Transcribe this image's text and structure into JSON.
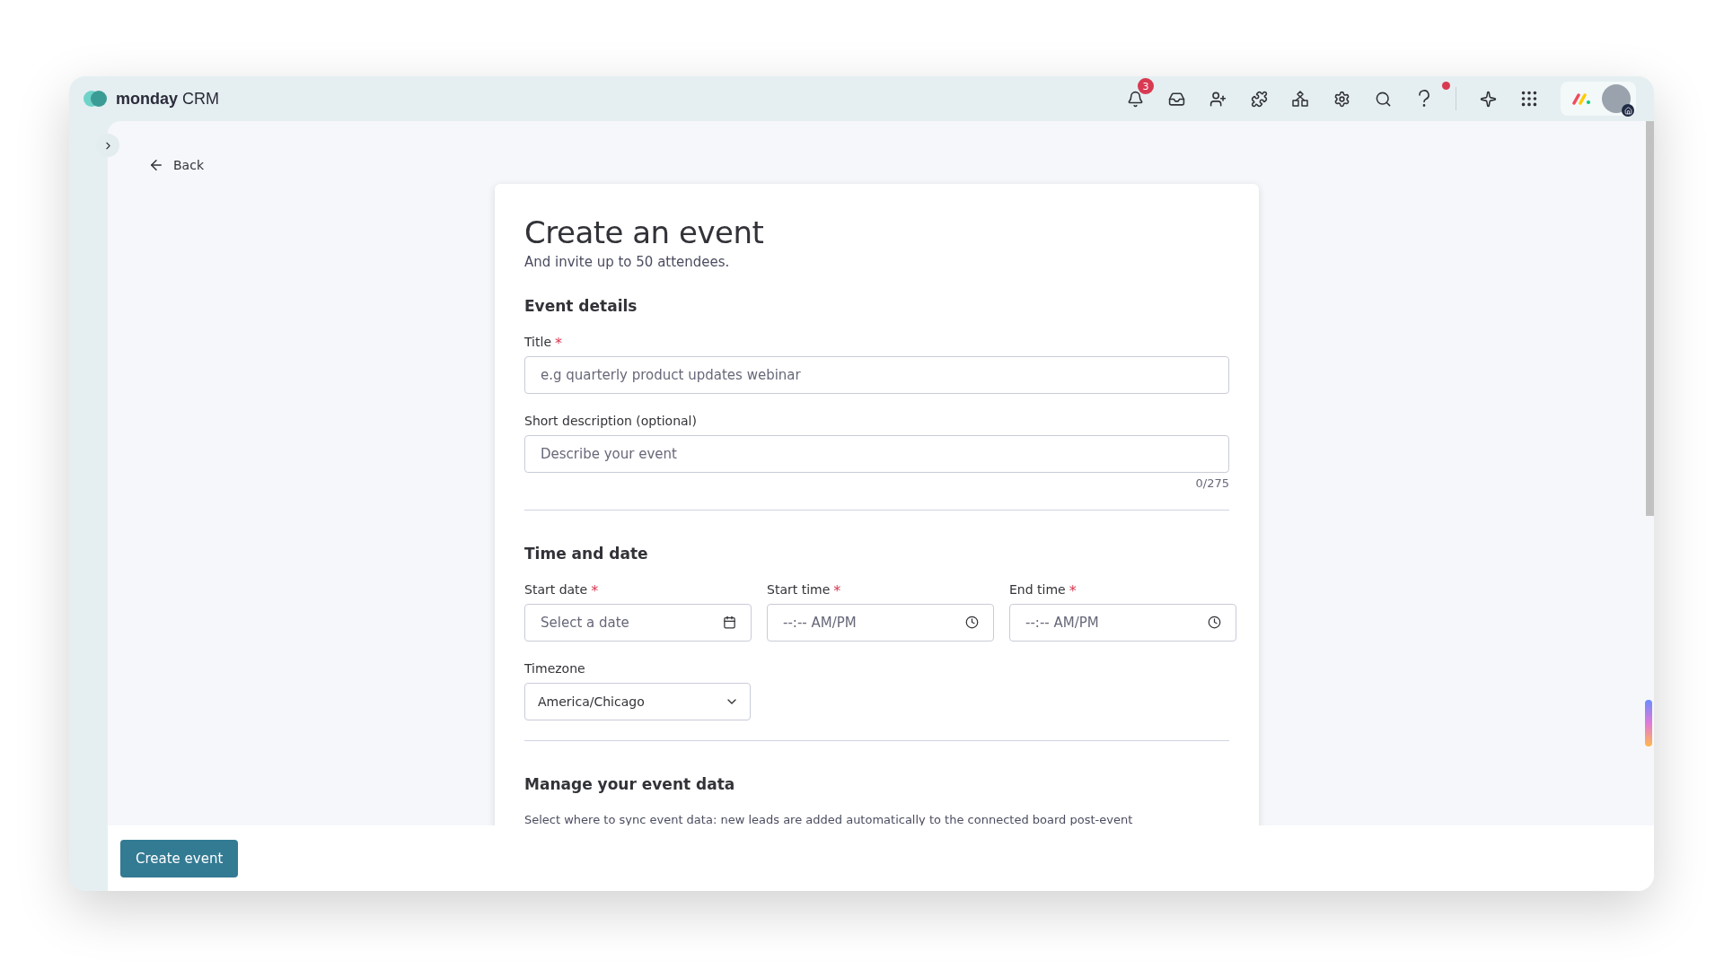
{
  "brand": {
    "name": "monday",
    "suffix": "CRM"
  },
  "header": {
    "notification_count": "3",
    "help_alert": true
  },
  "back": "Back",
  "form": {
    "title": "Create an event",
    "subtitle": "And invite up to 50 attendees.",
    "sections": [
      {
        "heading": "Event details",
        "rows": [
          [
            {
              "kind": "text",
              "label": "Title",
              "marker": "*",
              "placeholder": "e.g quarterly product updates webinar"
            }
          ],
          [
            {
              "kind": "text",
              "label": "Short description (optional)",
              "placeholder": "Describe your event",
              "counter": "0/275"
            }
          ]
        ]
      },
      {
        "heading": "Time and date",
        "rows": [
          [
            {
              "kind": "date",
              "label": "Start date",
              "marker": "*",
              "placeholder": "Select a date"
            },
            {
              "kind": "time",
              "label": "Start time",
              "marker": "*",
              "placeholder": "--:-- AM/PM"
            },
            {
              "kind": "time",
              "label": "End time",
              "marker": "*",
              "placeholder": "--:-- AM/PM"
            }
          ],
          [
            {
              "kind": "select",
              "label": "Timezone",
              "value": "America/Chicago"
            }
          ]
        ]
      },
      {
        "heading": "Manage your event data",
        "description": "Select where to sync event data: new leads are added automatically to the connected board post-event"
      }
    ]
  },
  "footer": {
    "button": "Create event"
  }
}
